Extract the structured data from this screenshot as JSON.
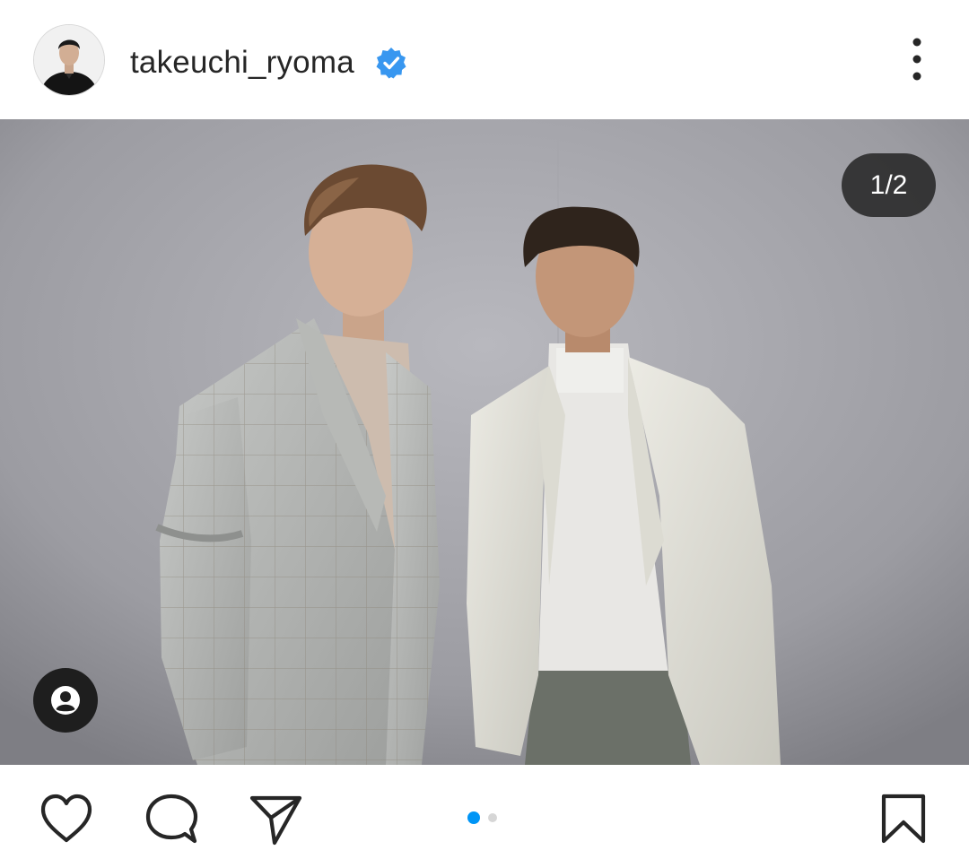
{
  "header": {
    "username": "takeuchi_ryoma",
    "verified": true,
    "avatar_icon": "profile-photo",
    "more_icon": "more-vertical-icon"
  },
  "post": {
    "counter": "1/2",
    "current_index": 1,
    "total_images": 2,
    "tags_icon": "user-tag-icon"
  },
  "actions": {
    "like_icon": "heart-icon",
    "comment_icon": "comment-icon",
    "share_icon": "send-icon",
    "save_icon": "bookmark-icon"
  },
  "colors": {
    "verified_blue": "#3897f0",
    "active_dot": "#0095f6",
    "inactive_dot": "#d6d6d6",
    "text": "#262626"
  }
}
